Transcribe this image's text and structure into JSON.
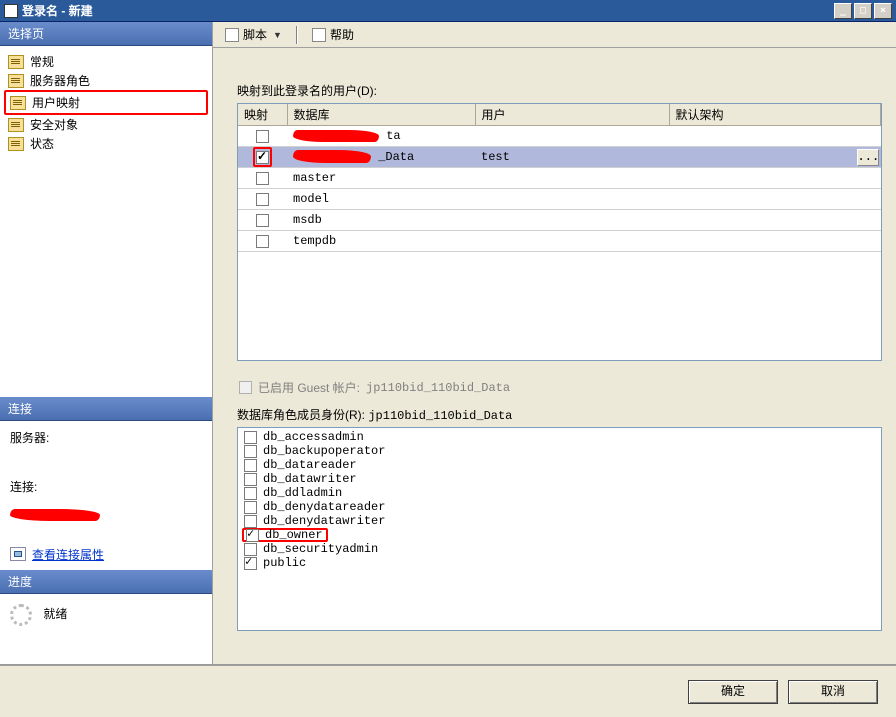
{
  "window": {
    "title": "登录名 - 新建",
    "min": "_",
    "max": "□",
    "close": "×"
  },
  "sidebar": {
    "select_page": "选择页",
    "items": [
      {
        "label": "常规"
      },
      {
        "label": "服务器角色"
      },
      {
        "label": "用户映射"
      },
      {
        "label": "安全对象"
      },
      {
        "label": "状态"
      }
    ],
    "connection_header": "连接",
    "server_label": "服务器:",
    "connection_label": "连接:",
    "view_props": "查看连接属性",
    "progress_header": "进度",
    "ready": "就绪"
  },
  "toolbar": {
    "script": "脚本",
    "help": "帮助"
  },
  "content": {
    "map_label": "映射到此登录名的用户(D):",
    "columns": {
      "c1": "映射",
      "c2": "数据库",
      "c3": "用户",
      "c4": "默认架构"
    },
    "rows": [
      {
        "checked": false,
        "db_suffix": "ta",
        "user": "",
        "selected": false
      },
      {
        "checked": true,
        "db_suffix": "_Data",
        "user": "test",
        "selected": true
      },
      {
        "checked": false,
        "db": "master",
        "user": "",
        "selected": false
      },
      {
        "checked": false,
        "db": "model",
        "user": "",
        "selected": false
      },
      {
        "checked": false,
        "db": "msdb",
        "user": "",
        "selected": false
      },
      {
        "checked": false,
        "db": "tempdb",
        "user": "",
        "selected": false
      }
    ],
    "ellipsis": "...",
    "guest_label": "已启用 Guest 帐户:",
    "guest_db": "jp110bid_110bid_Data",
    "roles_label_prefix": "数据库角色成员身份(R):",
    "roles_db": "jp110bid_110bid_Data",
    "roles": [
      {
        "name": "db_accessadmin",
        "checked": false
      },
      {
        "name": "db_backupoperator",
        "checked": false
      },
      {
        "name": "db_datareader",
        "checked": false
      },
      {
        "name": "db_datawriter",
        "checked": false
      },
      {
        "name": "db_ddladmin",
        "checked": false
      },
      {
        "name": "db_denydatareader",
        "checked": false
      },
      {
        "name": "db_denydatawriter",
        "checked": false
      },
      {
        "name": "db_owner",
        "checked": true,
        "highlight": true
      },
      {
        "name": "db_securityadmin",
        "checked": false
      },
      {
        "name": "public",
        "checked": true
      }
    ]
  },
  "footer": {
    "ok": "确定",
    "cancel": "取消"
  }
}
